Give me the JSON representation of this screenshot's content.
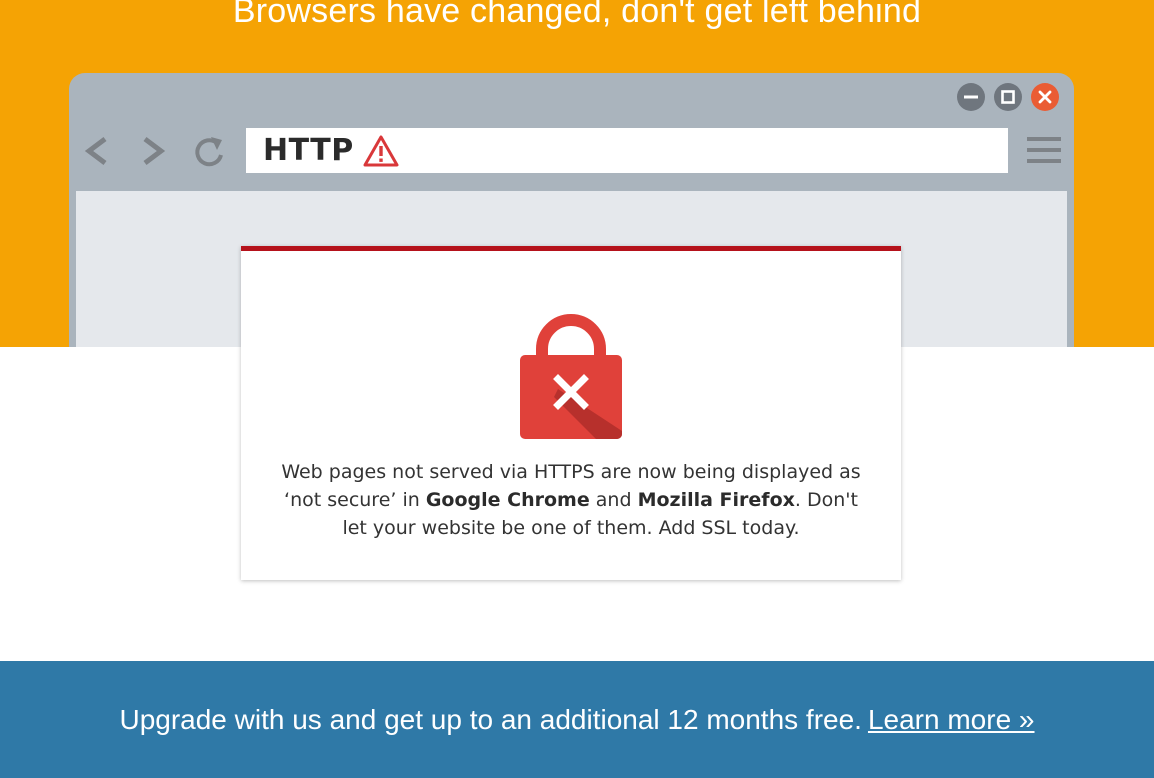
{
  "hero": {
    "title": "Browsers have changed, don't get left behind"
  },
  "browser": {
    "window_controls": {
      "minimize_icon": "minimize-icon",
      "maximize_icon": "maximize-icon",
      "close_icon": "close-icon"
    },
    "nav_icons": [
      "back-arrow-icon",
      "forward-arrow-icon",
      "reload-icon"
    ],
    "address_bar": {
      "protocol_label": "HTTP",
      "warning_icon": "warning-triangle-icon"
    },
    "menu_icon": "hamburger-menu-icon"
  },
  "card": {
    "lock_icon": "lock-error-icon",
    "text_part1": "Web pages not served via HTTPS are now being displayed as ‘not secure’ in ",
    "browser_1": "Google Chrome",
    "text_part2": " and ",
    "browser_2": "Mozilla Firefox",
    "text_part3": ". Don't let your website be one of them. Add SSL today."
  },
  "footer": {
    "promo_text": "Upgrade with us and get up to an additional 12 months free.",
    "link_text": "Learn more »"
  },
  "colors": {
    "hero_bg": "#f5a304",
    "browser_chrome": "#aab4bd",
    "card_accent": "#b5121b",
    "lock_red": "#e0413a",
    "close_button": "#ea5c34",
    "footer_bg": "#2f79a7"
  }
}
